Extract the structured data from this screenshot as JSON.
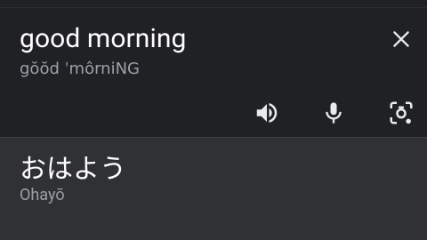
{
  "input": {
    "source_text": "good morning",
    "pronunciation": "gŏŏd ˈmôrniNG",
    "close_icon": "close-icon",
    "actions": [
      {
        "name": "speaker-icon"
      },
      {
        "name": "microphone-icon"
      },
      {
        "name": "camera-search-icon"
      }
    ]
  },
  "output": {
    "translated_text": "おはよう",
    "transliteration": "Ohayō"
  },
  "colors": {
    "background": "#202124",
    "output_panel": "#303134",
    "primary_text": "#ffffff",
    "secondary_text": "#9aa0a6",
    "icon": "#e8eaed"
  }
}
